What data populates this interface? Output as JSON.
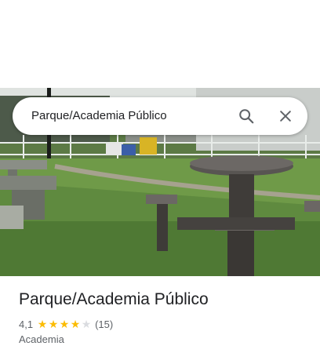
{
  "search": {
    "query": "Parque/Academia Público",
    "search_icon": "search-icon",
    "close_icon": "close-icon"
  },
  "place": {
    "name": "Parque/Academia Público",
    "rating": "4,1",
    "rating_value": 4.1,
    "rating_max": 5,
    "review_count": "(15)",
    "category": "Academia"
  },
  "colors": {
    "star": "#fbbc04",
    "star_empty": "#dadce0",
    "text_primary": "#202124",
    "text_secondary": "#5f6368"
  }
}
